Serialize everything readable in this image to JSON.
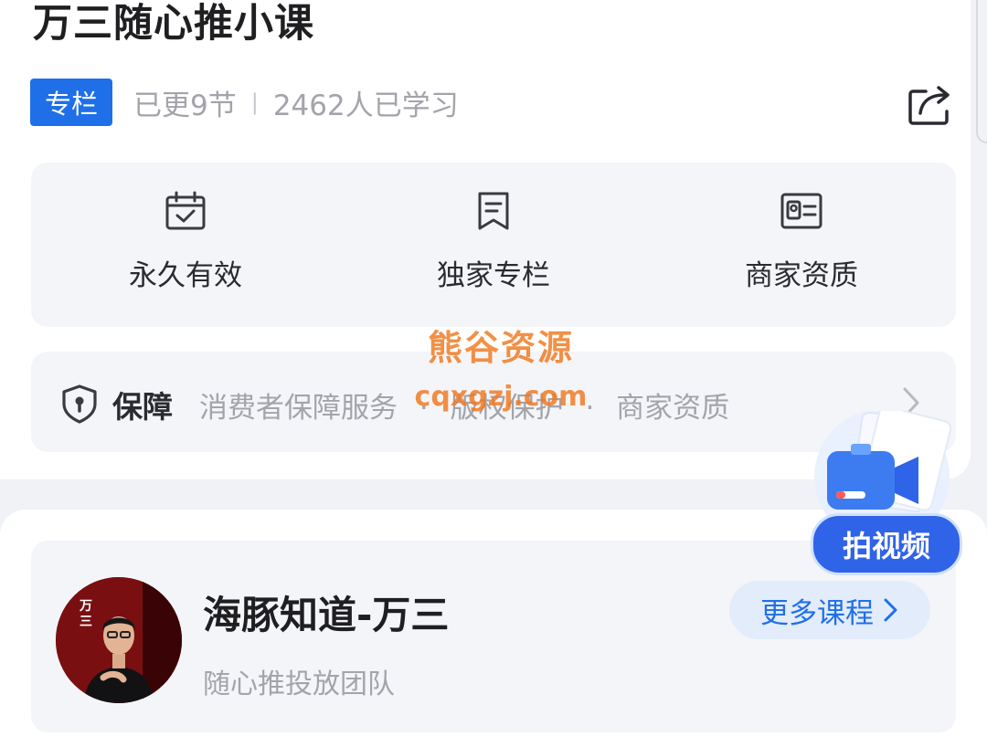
{
  "course": {
    "title": "万三随心推小课",
    "tag": "专栏",
    "updated": "已更9节",
    "separator": "|",
    "learners": "2462人已学习"
  },
  "features": [
    {
      "icon": "calendar-check-icon",
      "label": "永久有效"
    },
    {
      "icon": "bookmark-icon",
      "label": "独家专栏"
    },
    {
      "icon": "id-card-icon",
      "label": "商家资质"
    }
  ],
  "guarantee": {
    "icon": "shield-icon",
    "title": "保障",
    "items": [
      "消费者保障服务",
      "版权保护",
      "商家资质"
    ],
    "dot": "·"
  },
  "watermark": {
    "line1": "熊谷资源",
    "line2": "cqxgzj.com"
  },
  "floating": {
    "label": "拍视频",
    "icon": "video-camera-icon"
  },
  "author": {
    "name": "海豚知道-万三",
    "description": "随心推投放团队",
    "avatar_text": "万三",
    "more_button": "更多课程"
  },
  "colors": {
    "accent": "#1f6fe8",
    "watermark": "#f0781e"
  }
}
